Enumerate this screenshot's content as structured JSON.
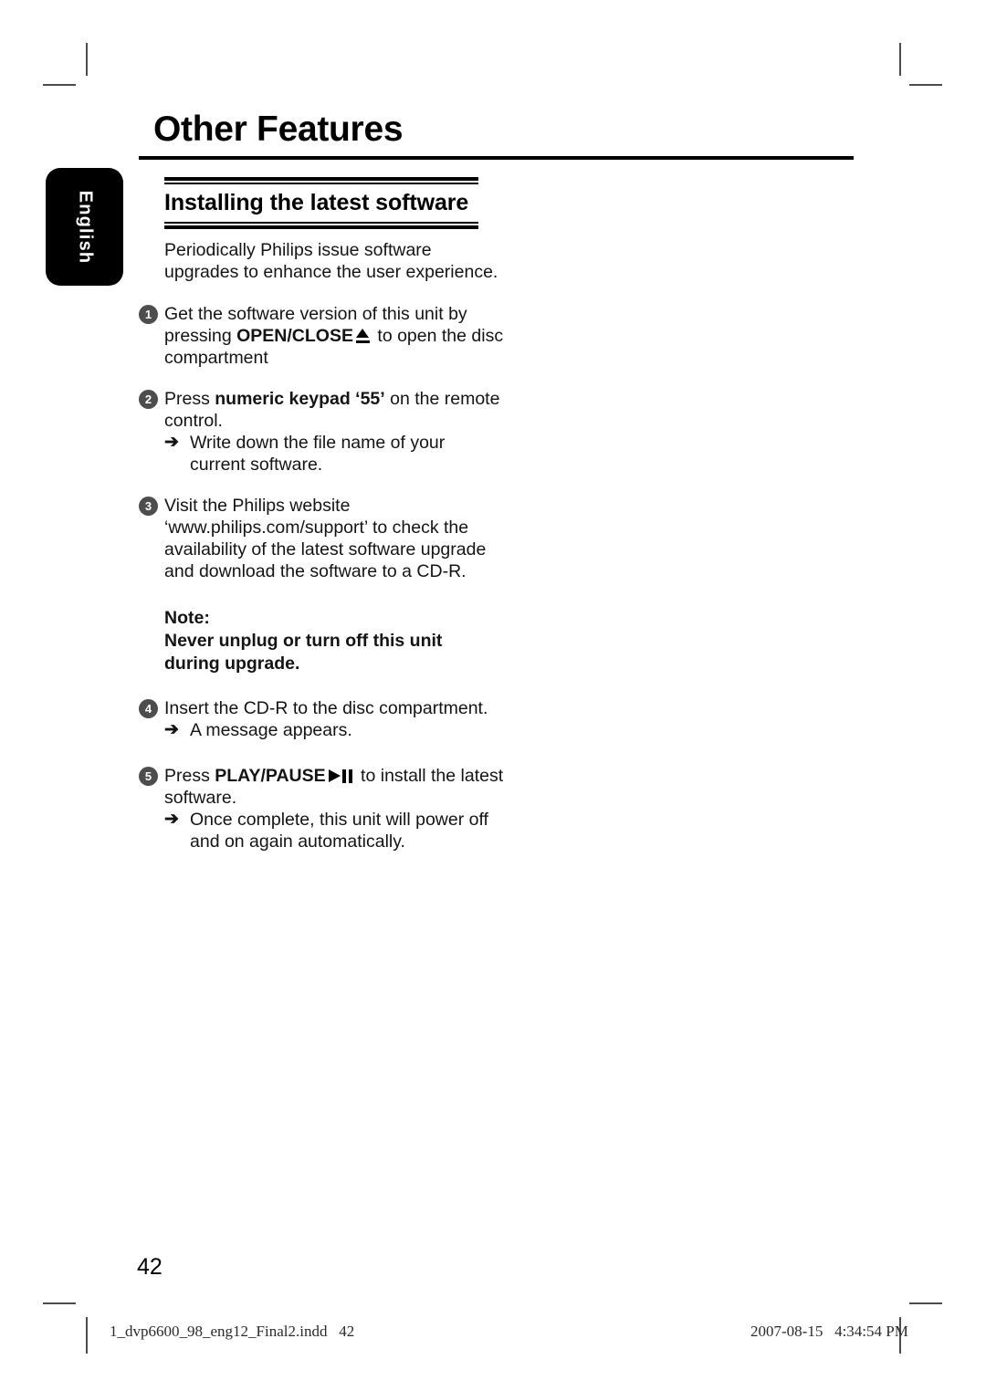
{
  "page_title": "Other Features",
  "language_tab": {
    "label": "English"
  },
  "section": {
    "heading": "Installing the latest software"
  },
  "intro": {
    "line1": "Periodically Philips issue software",
    "line2": "upgrades to enhance the user experience."
  },
  "steps": [
    {
      "number": "1",
      "text_before": "Get the software version of this unit by pressing ",
      "bold": "OPEN/CLOSE",
      "icon": "eject-icon",
      "text_after": " to open the disc compartment"
    },
    {
      "number": "2",
      "text_before": "Press ",
      "bold": "numeric keypad ‘55’",
      "text_after": " on the remote control.",
      "sub": {
        "arrow": "➔",
        "text": "Write down the file name of your current software."
      }
    },
    {
      "number": "3",
      "text_before": "Visit the Philips website ‘www.philips.com/support’ to check the availability of the latest software upgrade and download the software to a CD-R."
    },
    {
      "number": "4",
      "text_before": "Insert the CD-R to the disc compartment.",
      "sub": {
        "arrow": "➔",
        "text": "A message appears."
      }
    },
    {
      "number": "5",
      "text_before": "Press ",
      "bold": "PLAY/PAUSE",
      "icon": "play-pause-icon",
      "text_after": " to install the latest software.",
      "sub": {
        "arrow": "➔",
        "text": "Once complete, this unit will power off and on again automatically."
      }
    }
  ],
  "note": {
    "title": "Note:",
    "line1": "Never unplug or turn off this unit",
    "line2": "during upgrade."
  },
  "page_number": "42",
  "footer": {
    "left": "1_dvp6600_98_eng12_Final2.indd   42",
    "right": "2007-08-15   4:34:54 PM"
  },
  "colors": {
    "text": "#141414",
    "step_bullet_bg": "#4d4d4d",
    "tab_bg": "#000000",
    "crop_mark": "#4c4c4c"
  }
}
